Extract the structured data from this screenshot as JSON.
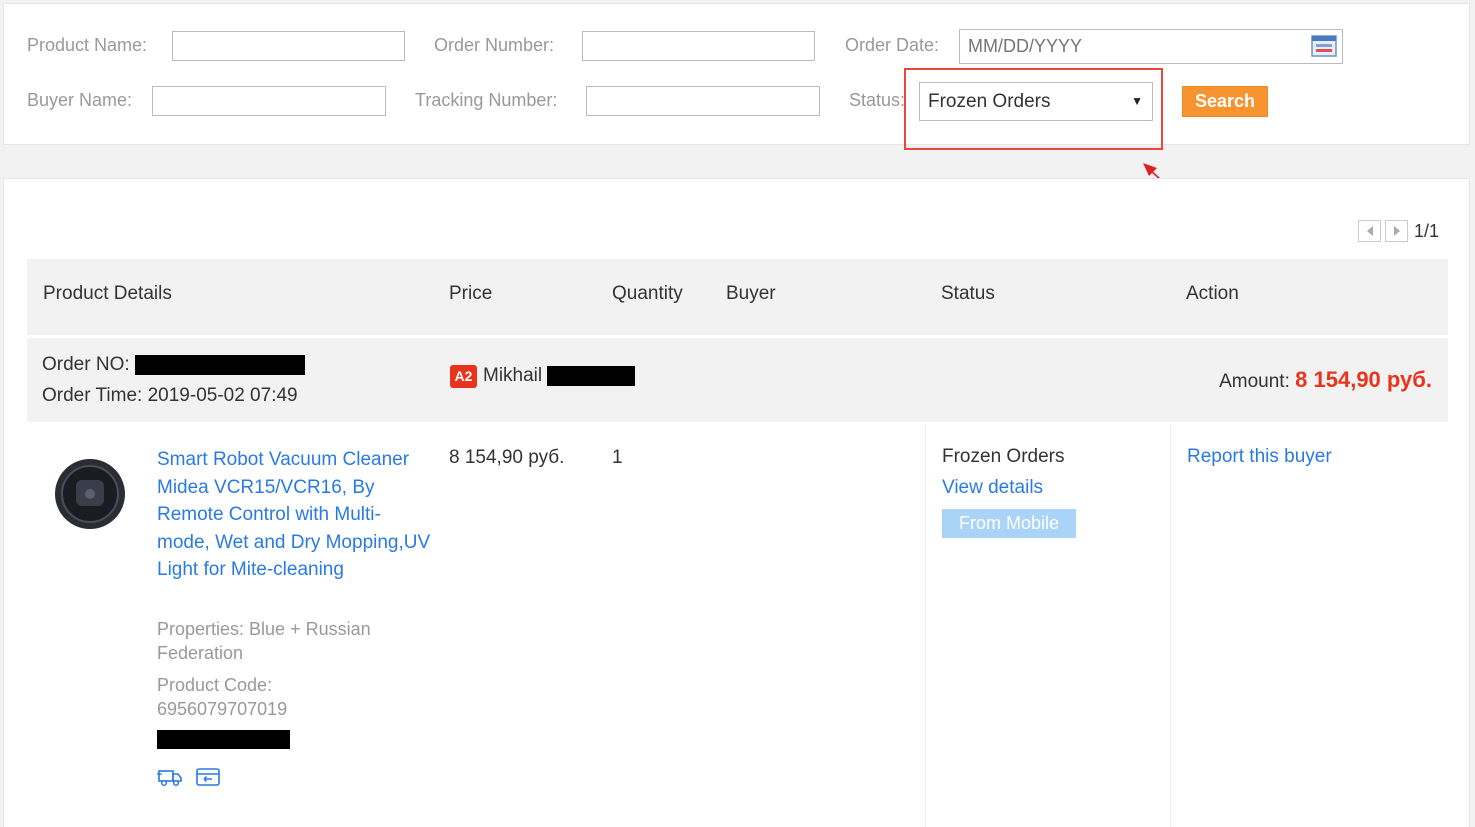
{
  "filters": {
    "product_name_label": "Product Name:",
    "order_number_label": "Order Number:",
    "order_date_label": "Order Date:",
    "order_date_placeholder": "MM/DD/YYYY",
    "buyer_name_label": "Buyer Name:",
    "tracking_number_label": "Tracking Number:",
    "status_label": "Status:",
    "status_selected": "Frozen Orders",
    "search_button": "Search"
  },
  "pagination": {
    "text": "1/1"
  },
  "table": {
    "headers": {
      "product_details": "Product Details",
      "price": "Price",
      "quantity": "Quantity",
      "buyer": "Buyer",
      "status": "Status",
      "action": "Action"
    }
  },
  "order": {
    "order_no_label": "Order NO:",
    "order_time_label": "Order Time:",
    "order_time": "2019-05-02 07:49",
    "buyer_badge": "A2",
    "buyer_name": "Mikhail",
    "amount_label": "Amount:",
    "amount_value": "8 154,90 руб.",
    "item": {
      "title": "Smart Robot Vacuum Cleaner Midea VCR15/VCR16, By Remote Control with Multi-mode, Wet and Dry Mopping,UV Light for Mite-cleaning",
      "properties": "Properties: Blue + Russian Federation",
      "product_code_label": "Product Code:",
      "product_code": "6956079707019",
      "price": "8 154,90 руб.",
      "quantity": "1",
      "status": "Frozen Orders",
      "view_details": "View details",
      "from_mobile": "From Mobile",
      "action": "Report this buyer"
    }
  },
  "colors": {
    "accent_orange": "#f7942f",
    "link_blue": "#2a7ae2",
    "amount_red": "#e8341c",
    "highlight_red": "#e8473f"
  }
}
